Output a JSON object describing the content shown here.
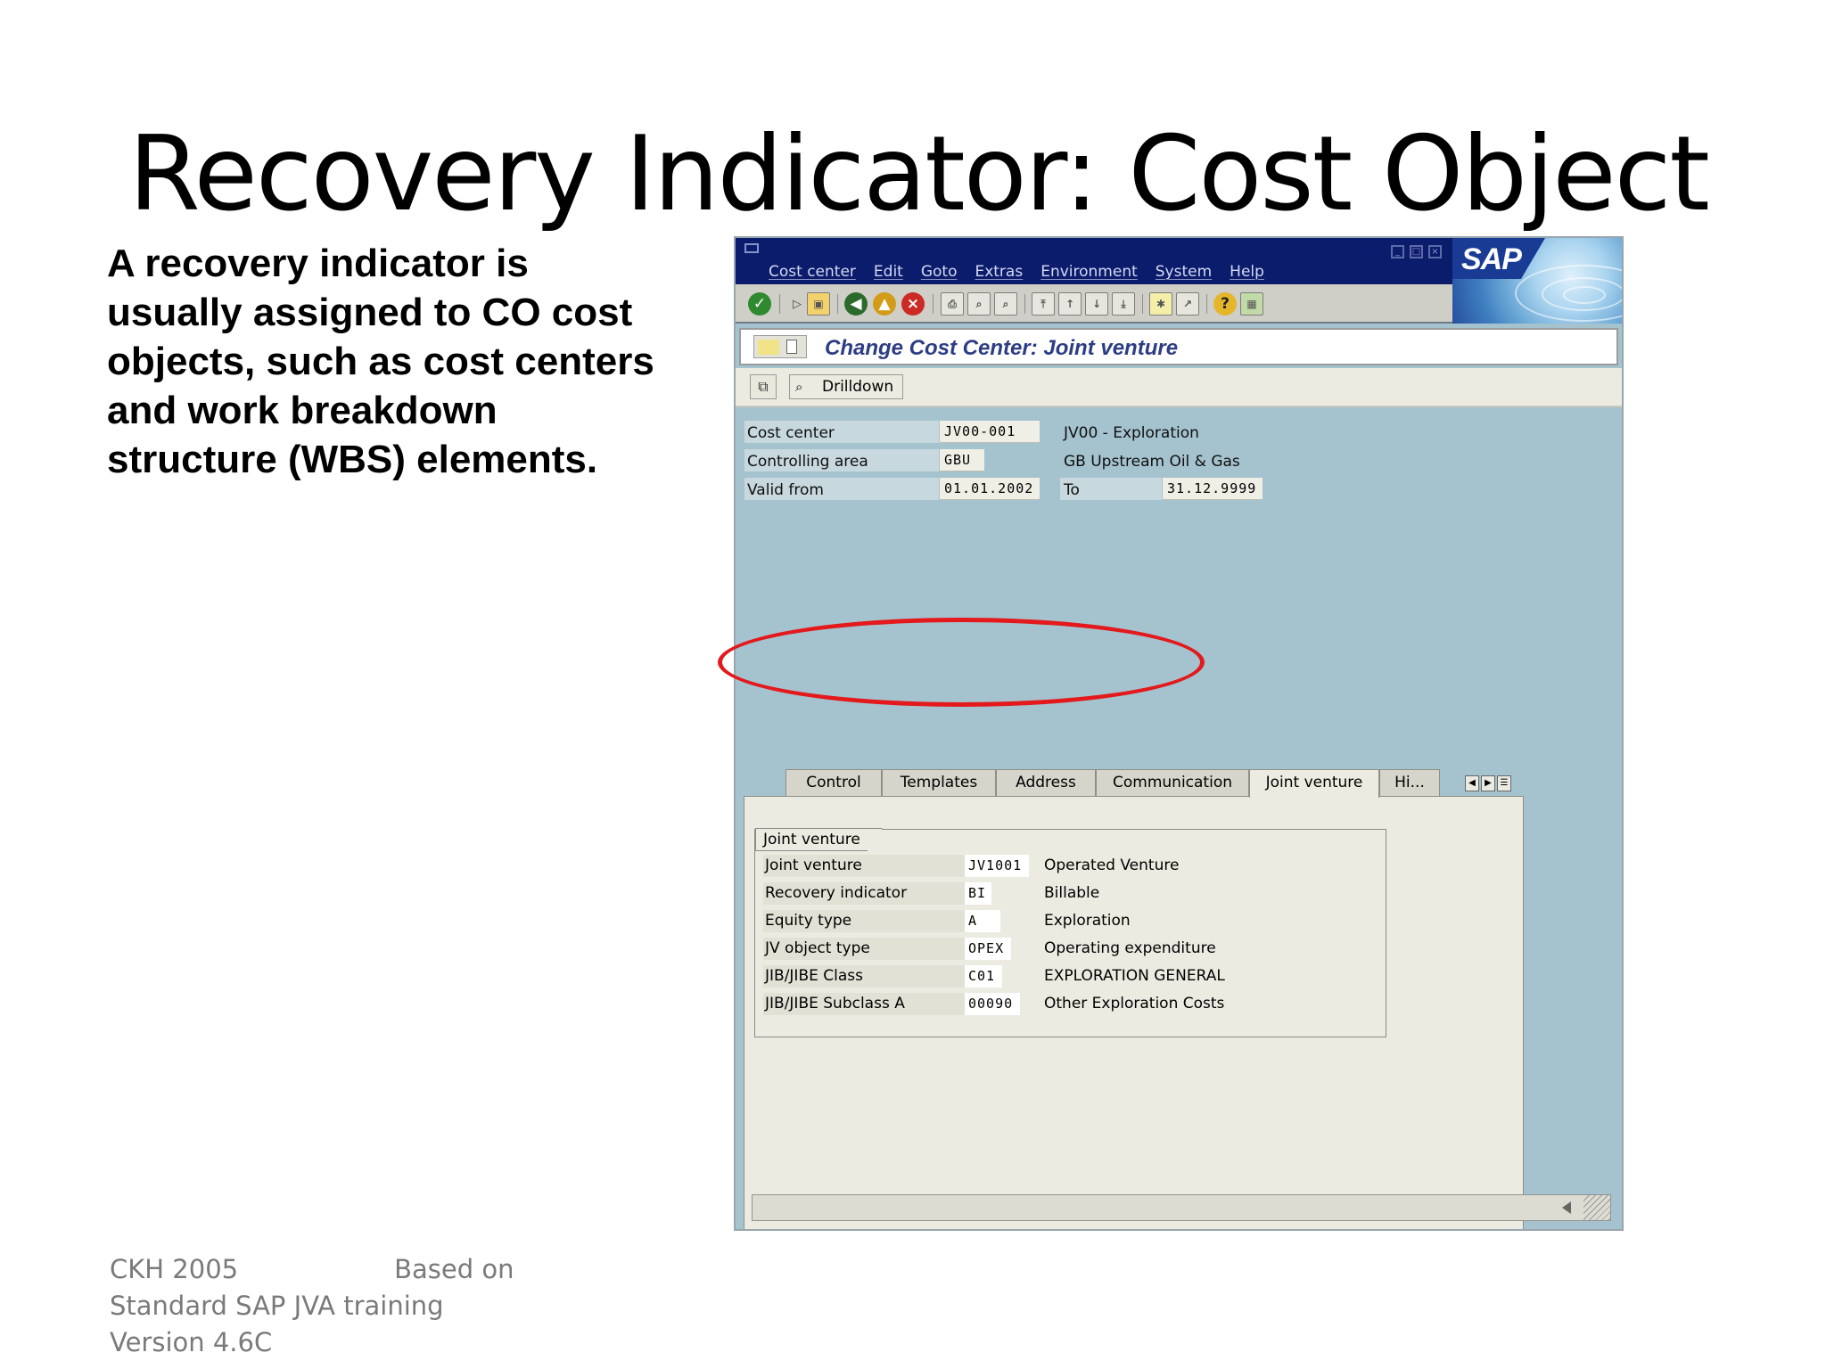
{
  "slide": {
    "title": "Recovery Indicator: Cost Object",
    "body": "A recovery indicator is usually assigned to CO cost objects, such as cost centers and work breakdown structure (WBS) elements.",
    "footer": {
      "line1_left": "CKH 2005",
      "line1_right": "Based on",
      "line2": "Standard SAP JVA training",
      "line3": "Version 4.6C"
    }
  },
  "sap": {
    "menu": [
      "Cost center",
      "Edit",
      "Goto",
      "Extras",
      "Environment",
      "System",
      "Help"
    ],
    "logo": "SAP",
    "screen_title": "Change Cost Center: Joint venture",
    "drilldown_label": "Drilldown",
    "header_fields": {
      "cost_center": {
        "label": "Cost center",
        "value": "JV00-001",
        "desc": "JV00 - Exploration"
      },
      "controlling_area": {
        "label": "Controlling area",
        "value": "GBU",
        "desc": "GB Upstream Oil & Gas"
      },
      "valid_from": {
        "label": "Valid from",
        "value": "01.01.2002",
        "to_label": "To",
        "to_value": "31.12.9999"
      }
    },
    "tabs": [
      "Control",
      "Templates",
      "Address",
      "Communication",
      "Joint venture",
      "Hi..."
    ],
    "active_tab": "Joint venture",
    "group_title": "Joint venture",
    "group_rows": [
      {
        "label": "Joint venture",
        "value": "JV1001",
        "desc": "Operated Venture"
      },
      {
        "label": "Recovery indicator",
        "value": "BI",
        "desc": "Billable"
      },
      {
        "label": "Equity type",
        "value": "A",
        "desc": "Exploration"
      },
      {
        "label": "JV object type",
        "value": "OPEX",
        "desc": "Operating expenditure"
      },
      {
        "label": "JIB/JIBE Class",
        "value": "C01",
        "desc": "EXPLORATION GENERAL"
      },
      {
        "label": "JIB/JIBE Subclass A",
        "value": "00090",
        "desc": "Other Exploration Costs"
      }
    ],
    "highlight_color": "#e3191c"
  }
}
